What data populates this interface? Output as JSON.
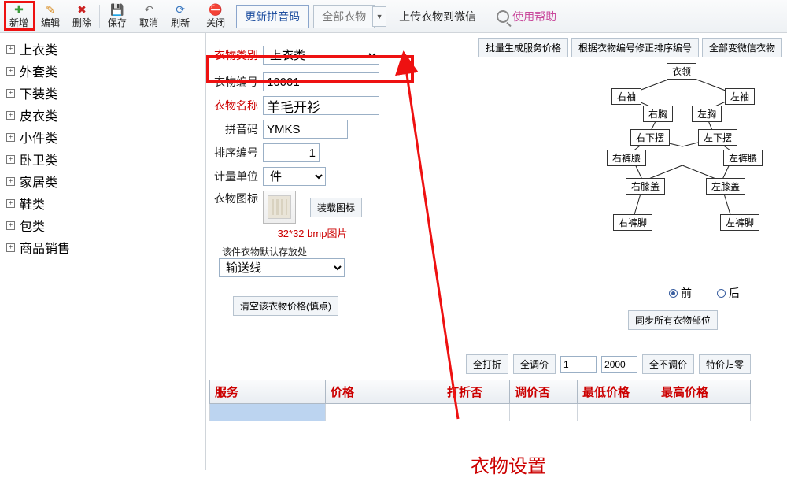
{
  "toolbar": {
    "new": "新增",
    "edit": "编辑",
    "del": "删除",
    "save": "保存",
    "cancel": "取消",
    "refresh": "刷新",
    "close": "关闭",
    "updatePinyin": "更新拼音码",
    "allClothes": "全部衣物",
    "uploadWechat": "上传衣物到微信",
    "help": "使用帮助"
  },
  "tree": [
    "上衣类",
    "外套类",
    "下装类",
    "皮衣类",
    "小件类",
    "卧卫类",
    "家居类",
    "鞋类",
    "包类",
    "商品销售"
  ],
  "rightButtons": {
    "batchGenPrice": "批量生成服务价格",
    "fixSort": "根据衣物编号修正排序编号",
    "allToWechat": "全部变微信衣物"
  },
  "form": {
    "catLabel": "衣物类别",
    "catVal": "上衣类",
    "codeLabel": "衣物编号",
    "codeVal": "10001",
    "nameLabel": "衣物名称",
    "nameVal": "羊毛开衫",
    "pinyinLabel": "拼音码",
    "pinyinVal": "YMKS",
    "sortLabel": "排序编号",
    "sortVal": "1",
    "unitLabel": "计量单位",
    "unitVal": "件",
    "iconLabel": "衣物图标",
    "loadIcon": "装载图标",
    "iconNote": "32*32 bmp图片",
    "storageNote": "该件衣物默认存放处",
    "storageVal": "输送线",
    "clearPrice": "清空该衣物价格(慎点)"
  },
  "diagram": {
    "collar": "衣领",
    "leftSleeve": "左袖",
    "rightSleeve": "右袖",
    "leftChest": "左胸",
    "rightChest": "右胸",
    "leftHem": "左下摆",
    "rightHem": "右下摆",
    "leftWaist": "左裤腰",
    "rightWaist": "右裤腰",
    "leftKnee": "左膝盖",
    "rightKnee": "右膝盖",
    "leftFoot": "左裤脚",
    "rightFoot": "右裤脚",
    "front": "前",
    "back": "后",
    "sync": "同步所有衣物部位"
  },
  "adjust": {
    "allDiscount": "全打折",
    "allAdjust": "全调价",
    "val1": "1",
    "val2": "2000",
    "allNoAdjust": "全不调价",
    "specialReset": "特价归零"
  },
  "table": {
    "cols": [
      "服务",
      "价格",
      "打折否",
      "调价否",
      "最低价格",
      "最高价格"
    ]
  },
  "bigText": "衣物设置"
}
